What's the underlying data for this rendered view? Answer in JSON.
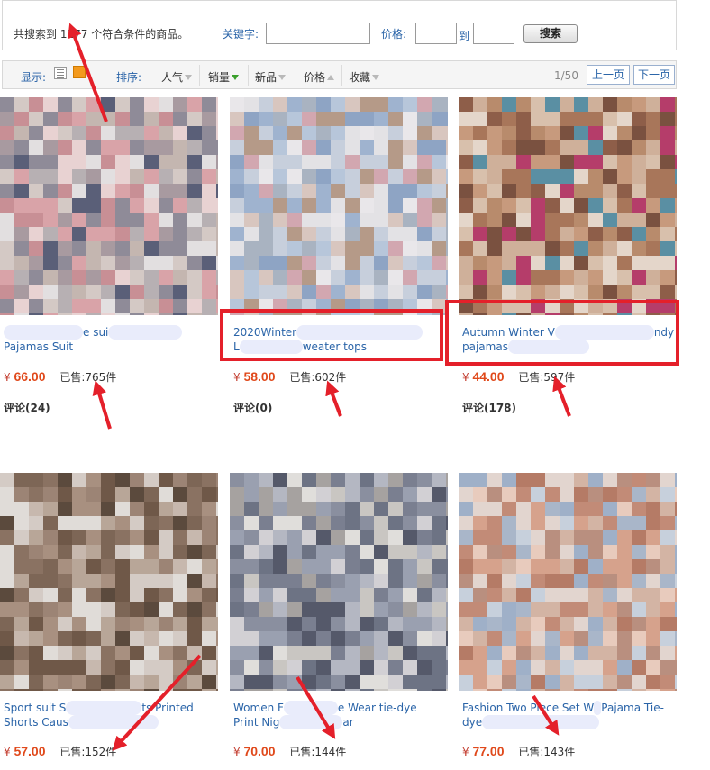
{
  "search": {
    "count_prefix": "共搜索到",
    "count": "1177",
    "count_suffix": "个符合条件的商品。",
    "keyword_label": "关键字:",
    "keyword_value": "",
    "price_label": "价格:",
    "price_from": "",
    "price_to_label": "到",
    "price_to": "",
    "search_button": "搜索"
  },
  "toolbar": {
    "display_label": "显示:",
    "sort_label": "排序:",
    "sort_options": [
      "人气",
      "销量",
      "新品",
      "价格",
      "收藏"
    ],
    "page_indicator": "1/50",
    "prev_button": "上一页",
    "next_button": "下一页"
  },
  "products": [
    {
      "title_line1_a": "",
      "title_line1_b": "e sui",
      "title_line2_a": "Pajamas Suit",
      "title_line2_b": "",
      "currency": "¥",
      "price": "66.00",
      "sold_label": "已售:",
      "sold": "765件",
      "review": "评论(24)"
    },
    {
      "title_line1_a": "2020Winter",
      "title_line1_b": "",
      "title_line2_a": "L",
      "title_line2_b": "weater tops",
      "currency": "¥",
      "price": "58.00",
      "sold_label": "已售:",
      "sold": "602件",
      "review": "评论(0)"
    },
    {
      "title_line1_a": "Autumn Winter V",
      "title_line1_b": "ndy",
      "title_line2_a": "pajamas",
      "title_line2_b": "",
      "currency": "¥",
      "price": "44.00",
      "sold_label": "已售:",
      "sold": "597件",
      "review": "评论(178)"
    },
    {
      "title_line1_a": "Sport suit S",
      "title_line1_b": "ts Printed",
      "title_line2_a": "Shorts Caus",
      "title_line2_b": "",
      "currency": "¥",
      "price": "57.00",
      "sold_label": "已售:",
      "sold": "152件",
      "review": ""
    },
    {
      "title_line1_a": "Women F",
      "title_line1_b": "e Wear tie-dye",
      "title_line2_a": "Print Nig",
      "title_line2_b": "ar",
      "currency": "¥",
      "price": "70.00",
      "sold_label": "已售:",
      "sold": "144件",
      "review": ""
    },
    {
      "title_line1_a": "Fashion Two Piece Set W",
      "title_line1_b": "Pajama Tie-",
      "title_line2_a": "dye",
      "title_line2_b": "",
      "currency": "¥",
      "price": "77.00",
      "sold_label": "已售:",
      "sold": "143件",
      "review": ""
    }
  ],
  "colors": {
    "link_blue": "#2a64a8",
    "price_orange": "#e0491b",
    "annotation_red": "#e4202a",
    "sort_active_green": "#3aa02c"
  },
  "icons": [
    "list-view-icon",
    "grid-view-icon",
    "sort-arrow-icon"
  ]
}
